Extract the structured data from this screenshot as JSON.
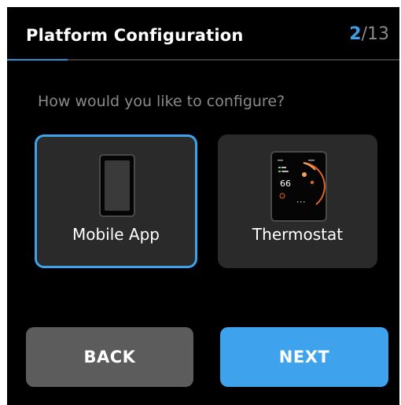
{
  "header": {
    "title": "Platform Configuration",
    "step_current": "2",
    "step_separator": "/",
    "step_total": "13",
    "progress_fraction": 0.1538
  },
  "prompt": "How would you like to configure?",
  "options": [
    {
      "label": "Mobile App",
      "icon": "phone-icon",
      "selected": true
    },
    {
      "label": "Thermostat",
      "icon": "thermostat-icon",
      "selected": false,
      "icon_display_temp": "66"
    }
  ],
  "buttons": {
    "back_label": "BACK",
    "next_label": "NEXT"
  },
  "colors": {
    "accent": "#3ea3ec",
    "background": "#000000",
    "card": "#2a2a2a",
    "back_button": "#5c5c5c"
  }
}
